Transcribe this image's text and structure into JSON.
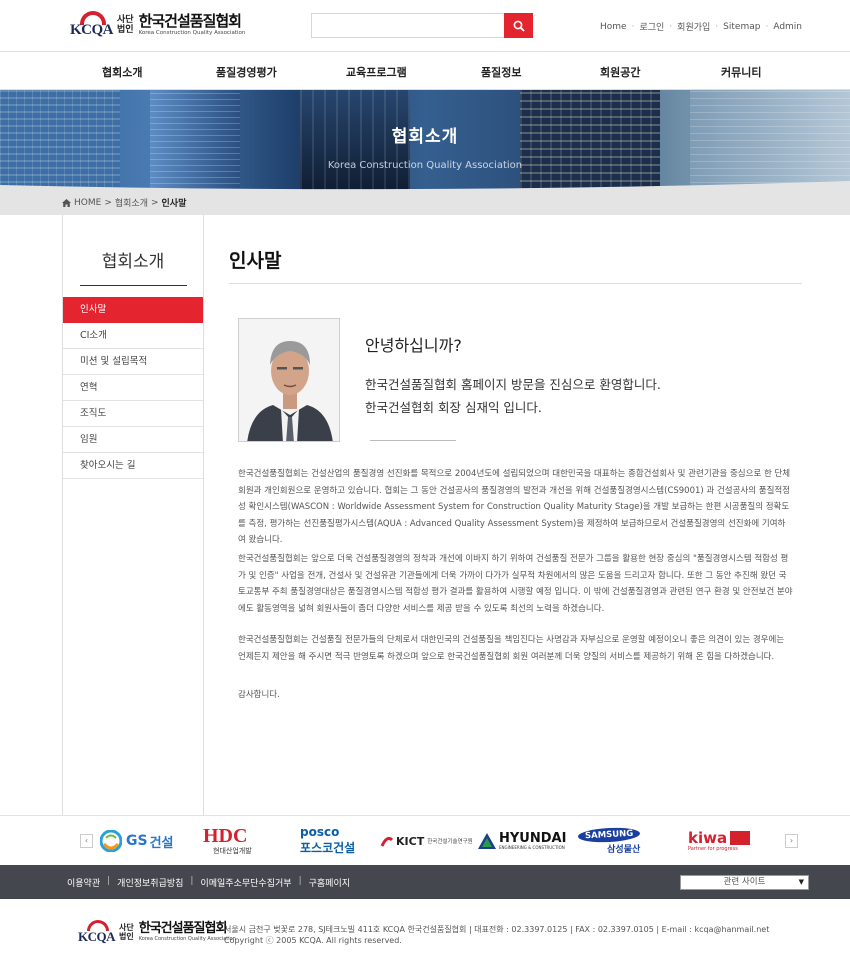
{
  "header": {
    "logo_mark": "KCQA",
    "logo_sub": [
      "사단",
      "법인"
    ],
    "logo_name": "한국건설품질협회",
    "logo_en": "Korea Construction Quality Association",
    "search_placeholder": "",
    "util_links": [
      "Home",
      "로그인",
      "회원가입",
      "Sitemap",
      "Admin"
    ]
  },
  "gnb": [
    "협회소개",
    "품질경영평가",
    "교육프로그램",
    "품질정보",
    "회원공간",
    "커뮤니티"
  ],
  "banner": {
    "title": "협회소개",
    "subtitle": "Korea Construction Quality Association"
  },
  "breadcrumb": {
    "home": "HOME",
    "section": "협회소개",
    "current": "인사말"
  },
  "sidebar": {
    "title": "협회소개",
    "items": [
      "인사말",
      "CI소개",
      "미션 및 설립목적",
      "연혁",
      "조직도",
      "임원",
      "찾아오시는 길"
    ],
    "active_index": 0
  },
  "content": {
    "title": "인사말",
    "greeting": "안녕하십니까?",
    "line1": "한국건설품질협회 홈페이지 방문을 진심으로 환영합니다.",
    "line2": "한국건설협회  회장 심재익 입니다.",
    "paragraphs": [
      "한국건설품질협회는 건설산업의 품질경영 선진화를 목적으로 2004년도에 설립되었으며 대한민국을 대표하는 종합건설회사 및 관련기관을 중심으로 한 단체 회원과 개인회원으로 운영하고 있습니다. 협회는 그 동안 건설공사의 품질경영의 발전과 개선을 위해 건설품질경영시스템(CS9001) 과 건설공사의 품질적정성 확인시스템(WASCON : Worldwide Assessment System for Construction Quality Maturity Stage)을 개발 보급하는 한편 시공품질의 정확도를 측정, 평가하는 선진품질평가시스템(AQUA : Advanced Quality Assessment System)을 제정하여 보급하므로서 건설품질경영의 선진화에 기여하여 왔습니다.",
      "한국건설품질협회는 앞으로 더욱 건설품질경영의 정착과 개선에 이바지 하기 위하여 건설품질 전문가 그룹을 활용한 현장 중심의 \"품질경영시스템 적합성 평가 및 인증\" 사업을 전개, 건설사 및 건설유관 기관들에게 더욱 가까이 다가가 실무적 차원에서의 많은 도움을 드리고자 합니다. 또한 그 동안 추진해 왔던 국토교통부 주최 품질경영대상은 품질경영시스템 적합성 평가 결과를 활용하여 시행할 예정 입니다. 이 밖에 건설품질경영과 관련된 연구 환경 및 안전보건 분야에도 활동영역을 넓혀 회원사들이 좀더 다양한 서비스를 제공 받을 수 있도록 최선의 노력을 하겠습니다.",
      "한국건설품질협회는 건설품질 전문가들의 단체로서 대한민국의 건설품질을 책임진다는 사명감과 자부심으로 운영할 예정이오니 좋은 의견이 있는 경우에는 언제든지 제안을 해 주시면 적극 반영토록 하겠으며 앞으로 한국건설품질협회 회원 여러분께 더욱 양질의 서비스를 제공하기 위해 온 힘을 다하겠습니다.",
      "감사합니다."
    ]
  },
  "partners": {
    "prev": "‹",
    "next": "›",
    "logos": [
      {
        "name": "GS건설",
        "text1": "GS",
        "text2": "건설"
      },
      {
        "name": "HDC",
        "text1": "HDC",
        "text2": "현대산업개발"
      },
      {
        "name": "포스코건설",
        "text1": "posco",
        "text2": "포스코건설"
      },
      {
        "name": "KICT",
        "text1": "KICT",
        "text2": "한국건설기술연구원"
      },
      {
        "name": "HYUNDAI",
        "text1": "HYUNDAI",
        "text2": "ENGINEERING & CONSTRUCTION"
      },
      {
        "name": "SAMSUNG",
        "text1": "SAMSUNG",
        "text2": "삼성물산"
      },
      {
        "name": "kiwa",
        "text1": "kiwa",
        "text2": "Partner for progress"
      }
    ]
  },
  "footer": {
    "links": [
      "이용약관",
      "개인정보취급방침",
      "이메일주소무단수집거부",
      "구홈페이지"
    ],
    "related_select": "관련 사이트",
    "address": "서울시 금천구 벚꽃로 278, SJ테크노빌 411호 KCQA 한국건설품질협회",
    "phone": "대표전화 : 02.3397.0125",
    "fax": "FAX : 02.3397.0105",
    "email": "E-mail : kcqa@hanmail.net",
    "copyright": "Copyright ⓒ 2005 KCQA.  All rights reserved."
  },
  "colors": {
    "accent": "#e4242f",
    "footer_bg": "#45474f",
    "logo_navy": "#1c2a57"
  }
}
